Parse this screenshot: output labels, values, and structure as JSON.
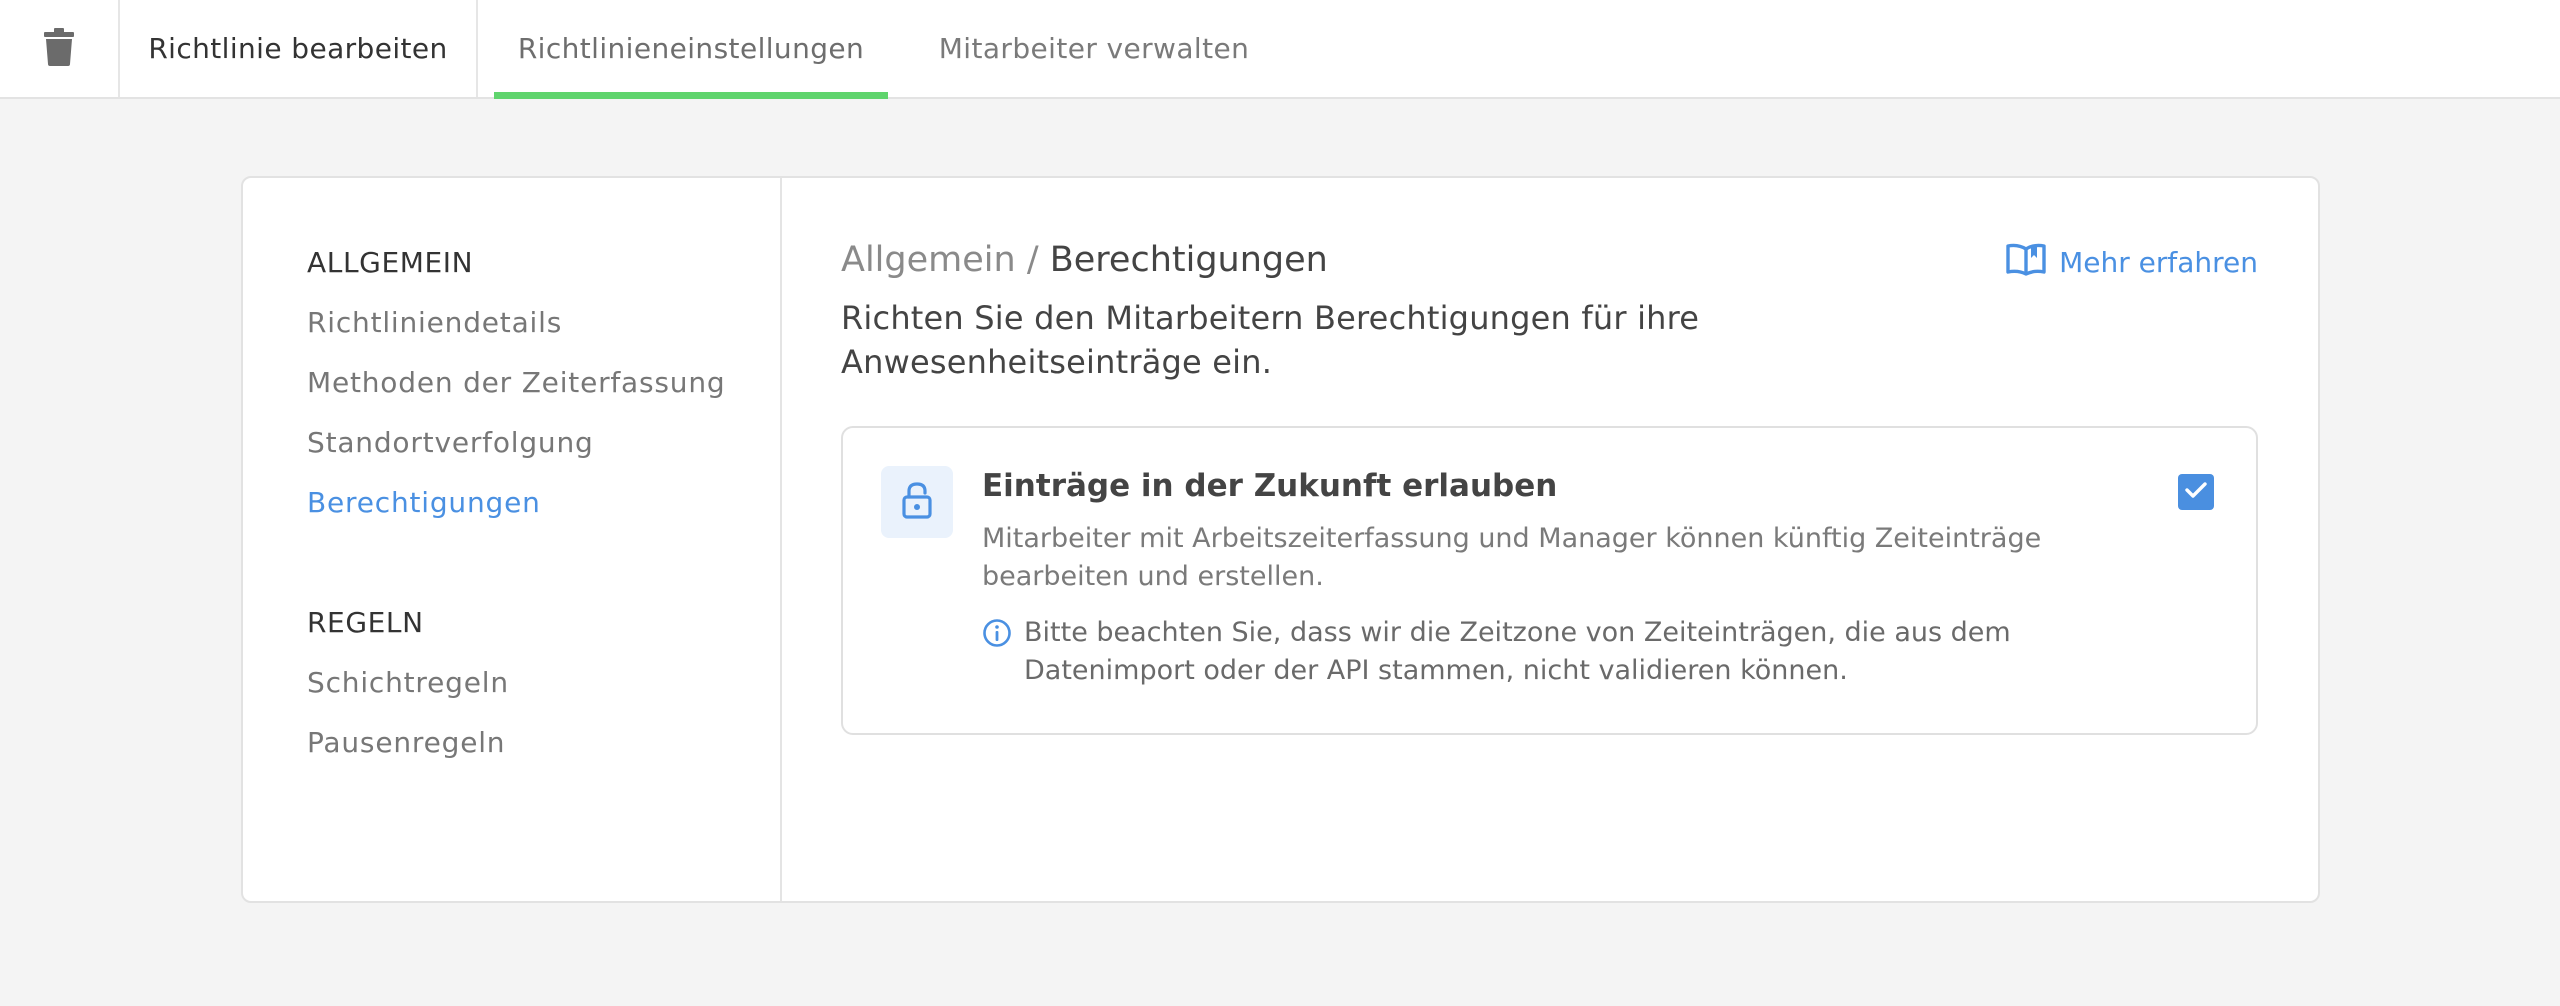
{
  "tabs": {
    "delete_icon": "trash-icon",
    "edit_policy": "Richtlinie bearbeiten",
    "policy_settings": "Richtlinieneinstellungen",
    "manage_staff": "Mitarbeiter verwalten",
    "active": "Richtlinieneinstellungen"
  },
  "sidebar": {
    "groups": [
      {
        "heading": "ALLGEMEIN",
        "items": [
          "Richtliniendetails",
          "Methoden der Zeiterfassung",
          "Standortverfolgung",
          "Berechtigungen"
        ]
      },
      {
        "heading": "REGELN",
        "items": [
          "Schichtregeln",
          "Pausenregeln"
        ]
      }
    ],
    "active_item": "Berechtigungen"
  },
  "main": {
    "breadcrumb_parent": "Allgemein",
    "breadcrumb_separator": "/",
    "breadcrumb_current": "Berechtigungen",
    "learn_more": "Mehr erfahren",
    "intro": "Richten Sie den Mitarbeitern Berechtigungen für ihre Anwesenheitseinträge ein.",
    "permission": {
      "title": "Einträge in der Zukunft erlauben",
      "description": "Mitarbeiter mit Arbeitszeiterfassung und Manager können künftig Zeiteinträge bearbeiten und erstellen.",
      "note": "Bitte beachten Sie, dass wir die Zeitzone von Zeiteinträgen, die aus dem Datenimport oder der API stammen, nicht validieren können.",
      "checked": true
    }
  },
  "colors": {
    "accent": "#4a90e2",
    "tab_underline": "#5fd46d",
    "background": "#f4f4f4"
  }
}
